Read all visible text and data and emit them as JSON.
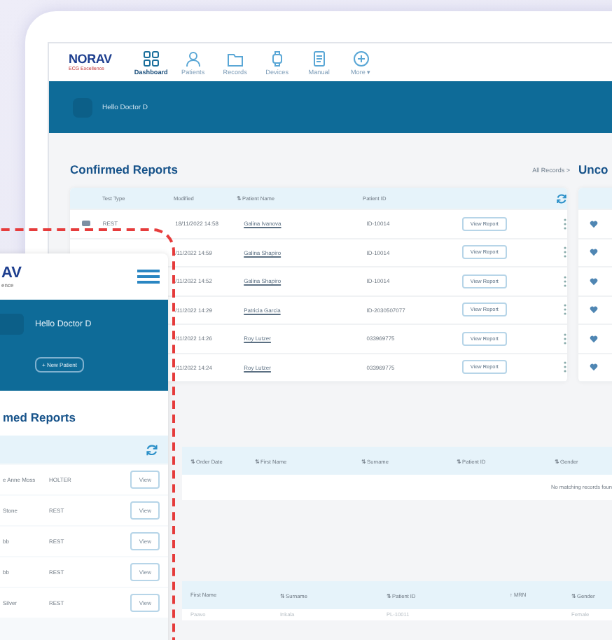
{
  "tablet": {
    "logo": {
      "name": "NORAV",
      "tagline": "ECG Excellence"
    },
    "nav": [
      {
        "label": "Dashboard",
        "selected": true
      },
      {
        "label": "Patients",
        "selected": false
      },
      {
        "label": "Records",
        "selected": false
      },
      {
        "label": "Devices",
        "selected": false
      },
      {
        "label": "Manual",
        "selected": false
      },
      {
        "label": "More ▾",
        "selected": false
      }
    ],
    "banner": {
      "greeting": "Hello Doctor D"
    },
    "confirmed_reports": {
      "title": "Confirmed Reports",
      "link": "All Records >",
      "columns": [
        "Test Type",
        "Modified",
        "⇅ Patient Name",
        "Patient ID"
      ],
      "rows": [
        {
          "test_type": "REST",
          "modified": "18/11/2022 14:58",
          "patient_name": "Galina Ivanova",
          "patient_id": "ID-10014",
          "action": "View Report"
        },
        {
          "modified": "/11/2022 14:59",
          "patient_name": "Galina Shapiro",
          "patient_id": "ID-10014",
          "action": "View Report"
        },
        {
          "modified": "/11/2022 14:52",
          "patient_name": "Galina Shapiro",
          "patient_id": "ID-10014",
          "action": "View Report"
        },
        {
          "modified": "/11/2022 14:29",
          "patient_name": "Patricia Garcia",
          "patient_id": "ID-2030507077",
          "action": "View Report"
        },
        {
          "modified": "/11/2022 14:26",
          "patient_name": "Roy Lutzer",
          "patient_id": "033969775",
          "action": "View Report"
        },
        {
          "modified": "/11/2022 14:24",
          "patient_name": "Roy Lutzer",
          "patient_id": "033969775",
          "action": "View Report"
        }
      ]
    },
    "side_panel": {
      "title": "Unco"
    },
    "orders_table": {
      "columns": [
        "⇅ Order Date",
        "⇅ First Name",
        "⇅ Surname",
        "⇅ Patient ID",
        "⇅ Gender"
      ],
      "empty_message": "No matching records foun"
    },
    "patients_table": {
      "columns": [
        "First Name",
        "⇅ Surname",
        "⇅ Patient ID",
        "↑ MRN",
        "⇅ Gender"
      ],
      "rows": [
        [
          "Paavo",
          "Inkala",
          "PL-10011",
          "",
          "Female"
        ]
      ]
    }
  },
  "phone": {
    "logo": {
      "name": "AV",
      "tagline": "ence"
    },
    "banner": {
      "greeting": "Hello Doctor D",
      "button": "+ New Patient"
    },
    "title": "med Reports",
    "rows": [
      {
        "name": "e Anne Moss",
        "test_type": "HOLTER",
        "action": "View"
      },
      {
        "name": "Stone",
        "test_type": "REST",
        "action": "View"
      },
      {
        "name": "bb",
        "test_type": "REST",
        "action": "View"
      },
      {
        "name": "bb",
        "test_type": "REST",
        "action": "View"
      },
      {
        "name": "Silver",
        "test_type": "REST",
        "action": "View"
      }
    ]
  }
}
